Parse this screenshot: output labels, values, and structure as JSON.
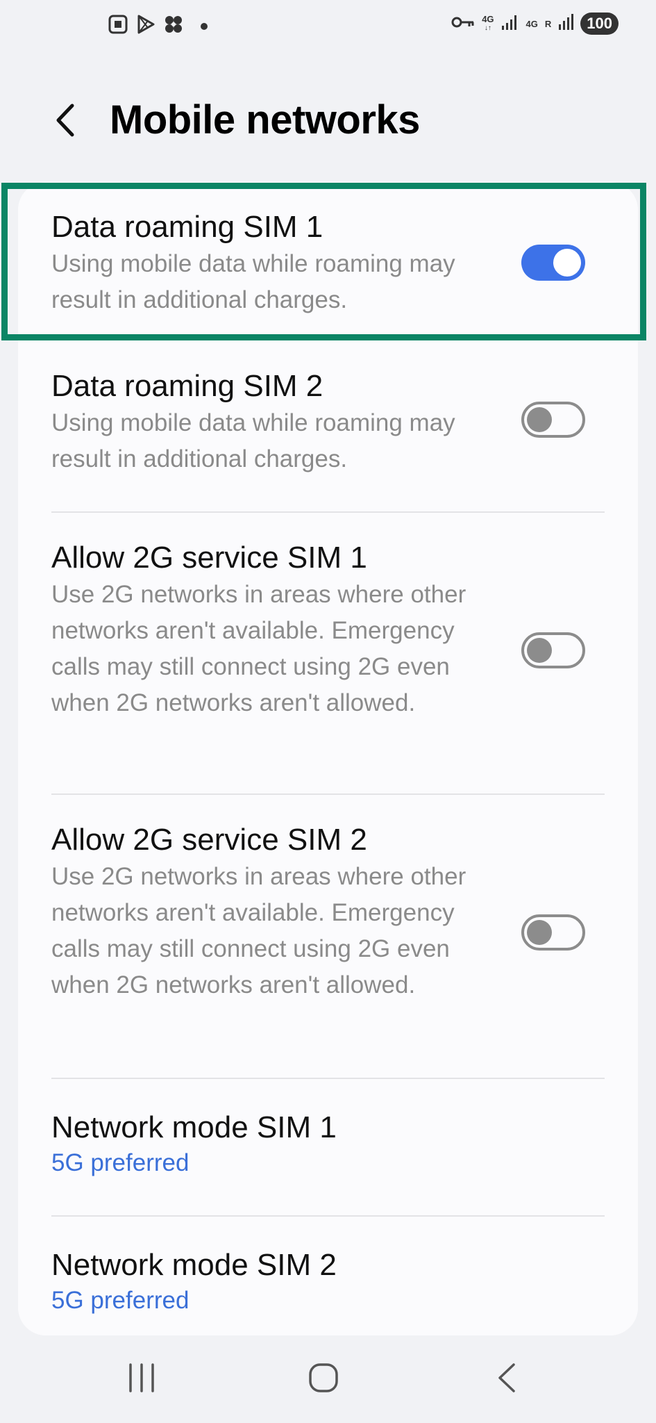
{
  "status_bar": {
    "left_icons": [
      "screenshot-icon",
      "play-store-icon",
      "pinwheel-icon",
      "notification-dot-icon"
    ],
    "right_icons": [
      "vpn-key-icon",
      "signal-icon",
      "signal-roaming-icon"
    ],
    "network_sim1": "4G",
    "network_sim2": "4G",
    "roaming_indicator": "R",
    "battery": "100"
  },
  "header": {
    "back_icon": "chevron-left-icon",
    "title": "Mobile networks"
  },
  "settings": [
    {
      "title": "Data roaming SIM 1",
      "description": "Using mobile data while roaming may result in additional charges.",
      "toggle": true
    },
    {
      "title": "Data roaming SIM 2",
      "description": "Using mobile data while roaming may result in additional charges.",
      "toggle": false
    },
    {
      "title": "Allow 2G service SIM 1",
      "description": "Use 2G networks in areas where other networks aren't available. Emergency calls may still connect using 2G even when 2G networks aren't allowed.",
      "toggle": false
    },
    {
      "title": "Allow 2G service SIM 2",
      "description": "Use 2G networks in areas where other networks aren't available. Emergency calls may still connect using 2G even when 2G networks aren't allowed.",
      "toggle": false
    },
    {
      "title": "Network mode SIM 1",
      "value": "5G preferred"
    },
    {
      "title": "Network mode SIM 2",
      "value": "5G preferred"
    }
  ],
  "colors": {
    "accent": "#3d72e8",
    "highlight": "#0b8565",
    "value_text": "#3a6fd8"
  },
  "nav_bar": {
    "icons": [
      "recents-icon",
      "home-icon",
      "back-icon"
    ]
  }
}
